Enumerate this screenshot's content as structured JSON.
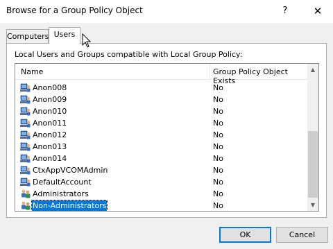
{
  "window": {
    "title": "Browse for a Group Policy Object",
    "help_glyph": "?",
    "close_glyph": "✕"
  },
  "tabs": [
    {
      "label": "Computers"
    },
    {
      "label": "Users"
    }
  ],
  "caption": "Local Users and Groups compatible with Local Group Policy:",
  "list": {
    "columns": {
      "name": "Name",
      "gpo": "Group Policy Object Exists"
    },
    "rows": [
      {
        "name": "Anon008",
        "exists": "No",
        "icon": "user-icon"
      },
      {
        "name": "Anon009",
        "exists": "No",
        "icon": "user-icon"
      },
      {
        "name": "Anon010",
        "exists": "No",
        "icon": "user-icon"
      },
      {
        "name": "Anon011",
        "exists": "No",
        "icon": "user-icon"
      },
      {
        "name": "Anon012",
        "exists": "No",
        "icon": "user-icon"
      },
      {
        "name": "Anon013",
        "exists": "No",
        "icon": "user-icon"
      },
      {
        "name": "Anon014",
        "exists": "No",
        "icon": "user-icon"
      },
      {
        "name": "CtxAppVCOMAdmin",
        "exists": "No",
        "icon": "user-icon"
      },
      {
        "name": "DefaultAccount",
        "exists": "No",
        "icon": "user-icon"
      },
      {
        "name": "Administrators",
        "exists": "No",
        "icon": "group-icon"
      },
      {
        "name": "Non-Administrators",
        "exists": "No",
        "icon": "group-icon",
        "selected": true
      }
    ],
    "scroll_position": 1.0
  },
  "buttons": {
    "ok": "OK",
    "cancel": "Cancel"
  },
  "colors": {
    "selection": "#0078d7",
    "ok_border": "#0078d7"
  }
}
